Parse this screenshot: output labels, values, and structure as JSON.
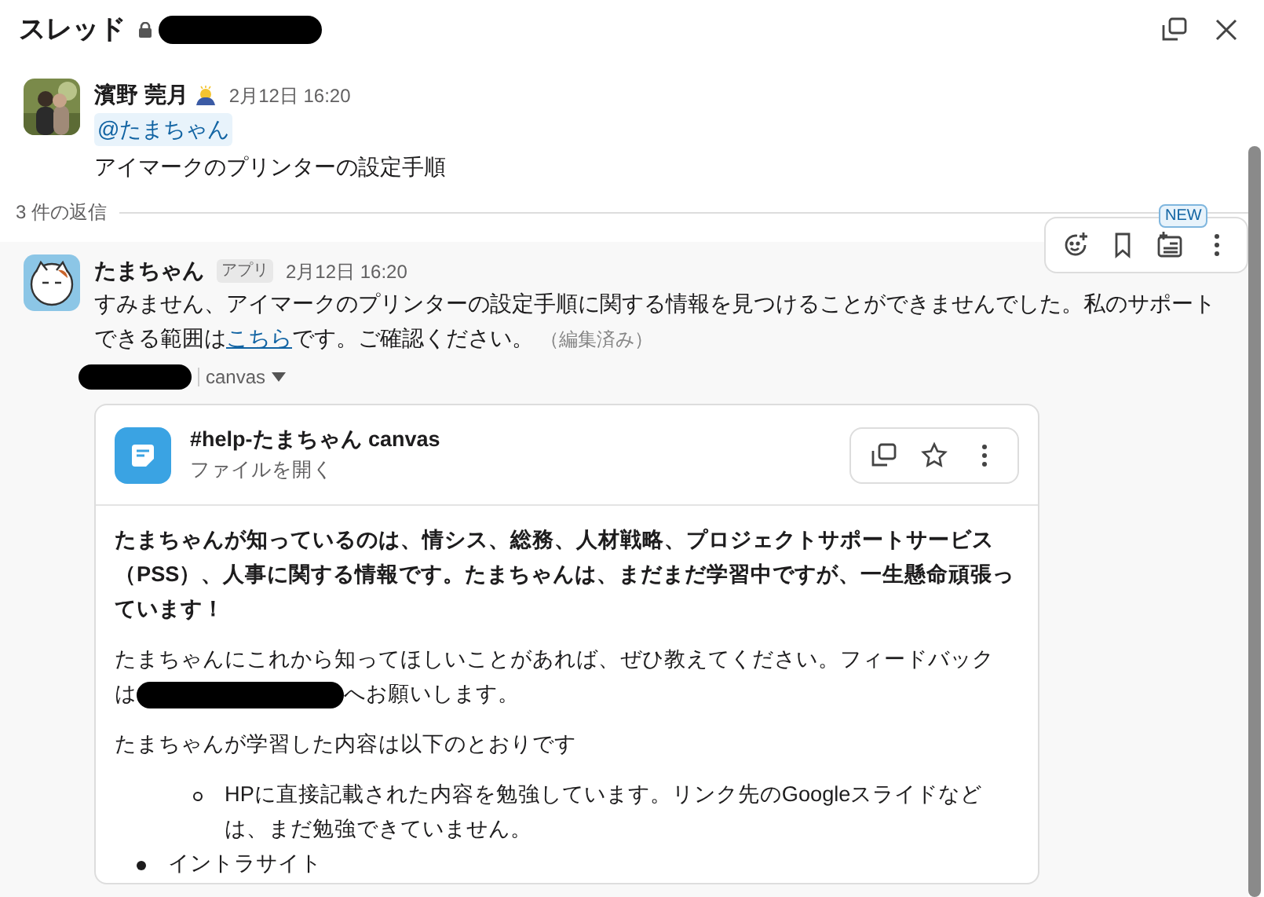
{
  "header": {
    "title": "スレッド"
  },
  "parent_message": {
    "author": "濱野 莞月",
    "time": "2月12日 16:20",
    "mention": "@たまちゃん",
    "text": "アイマークのプリンターの設定手順"
  },
  "reply_count": "3 件の返信",
  "hover_toolbar": {
    "badge": "NEW"
  },
  "reply": {
    "author": "たまちゃん",
    "badge": "アプリ",
    "time": "2月12日 16:20",
    "text_before": "すみません、アイマークのプリンターの設定手順に関する情報を見つけることができませんでした。私のサポートできる範囲は",
    "link": "こちら",
    "text_after": "です。ご確認ください。",
    "edited": "（編集済み）",
    "attachment_label": "canvas",
    "canvas": {
      "title": "#help-たまちゃん canvas",
      "subtitle": "ファイルを開く",
      "blocks": [
        {
          "kind": "bold",
          "text": "たまちゃんが知っているのは、情シス、総務、人材戦略、プロジェクトサポートサービス（PSS）、人事に関する情報です。たまちゃんは、まだまだ学習中ですが、一生懸命頑張っています！"
        },
        {
          "kind": "redacted",
          "lines": [
            {
              "text": "たまちゃんにこれから知ってほしいことがあれば、ぜひ教えてください。フィードバック"
            },
            {
              "before": "は",
              "after": "へお願いします。"
            }
          ]
        },
        {
          "kind": "plain",
          "text": "たまちゃんが学習した内容は以下のとおりです"
        },
        {
          "kind": "list",
          "items": [
            {
              "children": [
                {
                  "text": "HPに直接記載された内容を勉強しています。リンク先のGoogleスライドなどは、まだ勉強できていません。"
                }
              ]
            },
            {
              "text": "イントラサイト"
            }
          ]
        }
      ]
    }
  }
}
